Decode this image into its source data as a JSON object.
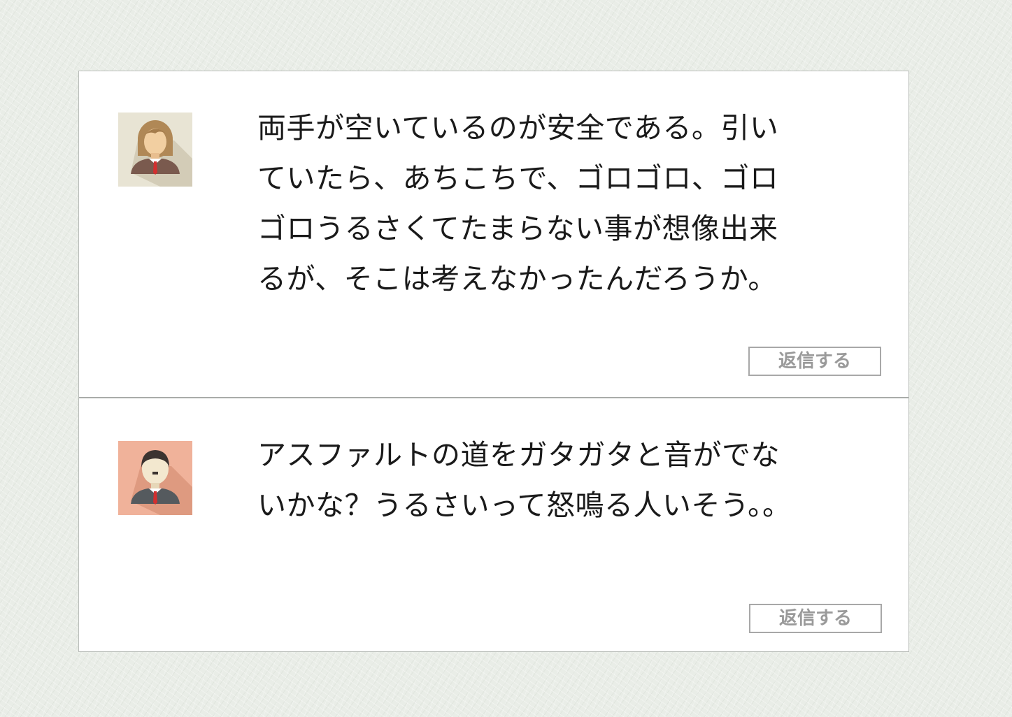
{
  "colors": {
    "background": "#e9ede7",
    "card": "#ffffff",
    "divider": "#a9aca9",
    "button_text": "#9a9a9a",
    "avatar_woman_bg": "#e8e4d4",
    "avatar_man_bg": "#f0b29a",
    "tie": "#d32f2f"
  },
  "comments": [
    {
      "avatar_icon": "woman-user-icon",
      "text": "両手が空いているのが安全である。引いていたら、あちこちで、ゴロゴロ、ゴロゴロうるさくてたまらない事が想像出来るが、そこは考えなかったんだろうか。",
      "reply_label": "返信する"
    },
    {
      "avatar_icon": "man-user-icon",
      "text": "アスファルトの道をガタガタと音がでないかな？うるさいって怒鳴る人いそう。。",
      "reply_label": "返信する"
    }
  ]
}
